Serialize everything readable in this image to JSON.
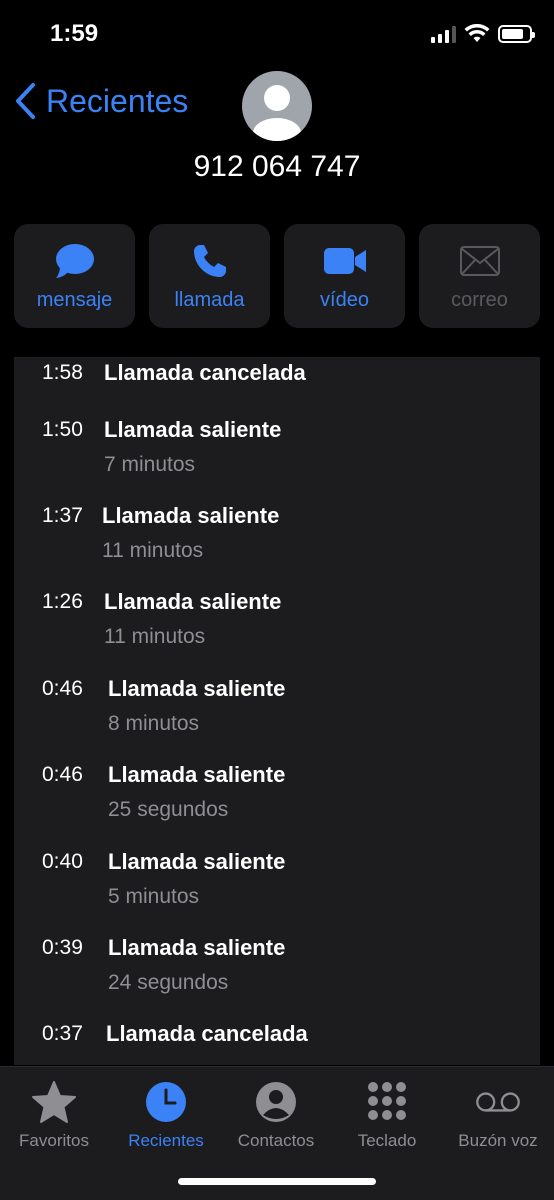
{
  "status_bar": {
    "time": "1:59"
  },
  "header": {
    "back_label": "Recientes",
    "phone_number": "912 064 747"
  },
  "actions": [
    {
      "label": "mensaje",
      "icon": "message-icon",
      "enabled": true
    },
    {
      "label": "llamada",
      "icon": "phone-icon",
      "enabled": true
    },
    {
      "label": "vídeo",
      "icon": "video-icon",
      "enabled": true
    },
    {
      "label": "correo",
      "icon": "mail-icon",
      "enabled": false
    }
  ],
  "calls": [
    {
      "time": "1:58",
      "type": "Llamada cancelada",
      "duration": ""
    },
    {
      "time": "1:50",
      "type": "Llamada saliente",
      "duration": "7 minutos"
    },
    {
      "time": "1:37",
      "type": "Llamada saliente",
      "duration": "11 minutos"
    },
    {
      "time": "1:26",
      "type": "Llamada saliente",
      "duration": "11 minutos"
    },
    {
      "time": "0:46",
      "type": "Llamada saliente",
      "duration": "8 minutos"
    },
    {
      "time": "0:46",
      "type": "Llamada saliente",
      "duration": "25 segundos"
    },
    {
      "time": "0:40",
      "type": "Llamada saliente",
      "duration": "5 minutos"
    },
    {
      "time": "0:39",
      "type": "Llamada saliente",
      "duration": "24 segundos"
    },
    {
      "time": "0:37",
      "type": "Llamada cancelada",
      "duration": ""
    }
  ],
  "tabbar": {
    "tabs": [
      {
        "label": "Favoritos",
        "icon": "star-icon",
        "active": false
      },
      {
        "label": "Recientes",
        "icon": "clock-icon",
        "active": true
      },
      {
        "label": "Contactos",
        "icon": "contact-icon",
        "active": false
      },
      {
        "label": "Teclado",
        "icon": "keypad-icon",
        "active": false
      },
      {
        "label": "Buzón voz",
        "icon": "voicemail-icon",
        "active": false
      }
    ]
  },
  "colors": {
    "accent": "#3b82f6",
    "background": "#000000",
    "card": "#1c1c1e",
    "secondary_text": "#8e8e93"
  }
}
